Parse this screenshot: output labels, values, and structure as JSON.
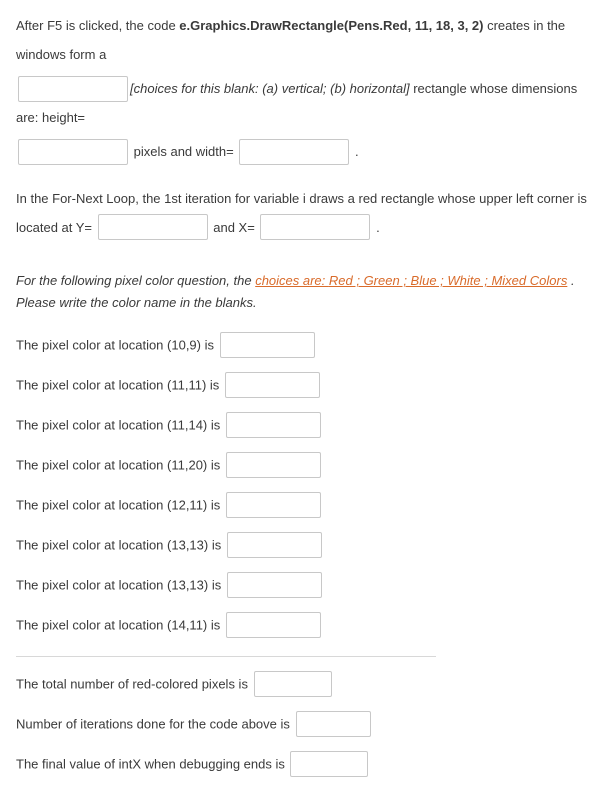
{
  "q1": {
    "intro_a": "After F5 is clicked, the code ",
    "code": "e.Graphics.DrawRectangle(Pens.Red, 11, 18, 3, 2)",
    "intro_b": " creates in the windows form a ",
    "choices_note": "[choices for this blank: (a) vertical; (b) horizontal]",
    "post_choices": " rectangle whose dimensions are: height=",
    "pixels_and_width": " pixels and width=",
    "period": "."
  },
  "q2": {
    "text_a": "In the For-Next Loop, the 1st iteration for variable i draws a red rectangle whose upper left corner is located at Y=",
    "and_x": " and X=",
    "period": "."
  },
  "color_intro": {
    "prefix": "For the following pixel color question, the ",
    "choices_label": "choices are: ",
    "choices_colors": "Red ; Green ; Blue ; White ; Mixed Colors",
    "suffix": " . Please write the color name in the blanks."
  },
  "pixels": [
    "The pixel color at location (10,9) is",
    "The pixel color at location (11,11) is",
    "The pixel color at location (11,14) is",
    "The pixel color at location (11,20) is",
    "The pixel color at location (12,11) is",
    "The pixel color at location (13,13) is",
    "The pixel color at location (13,13) is",
    "The pixel color at location (14,11) is"
  ],
  "totals": {
    "red_pixels": "The total number of red-colored pixels is",
    "iterations": "Number of iterations done for the code above is",
    "final_intx": "The final value of intX when debugging ends is"
  }
}
